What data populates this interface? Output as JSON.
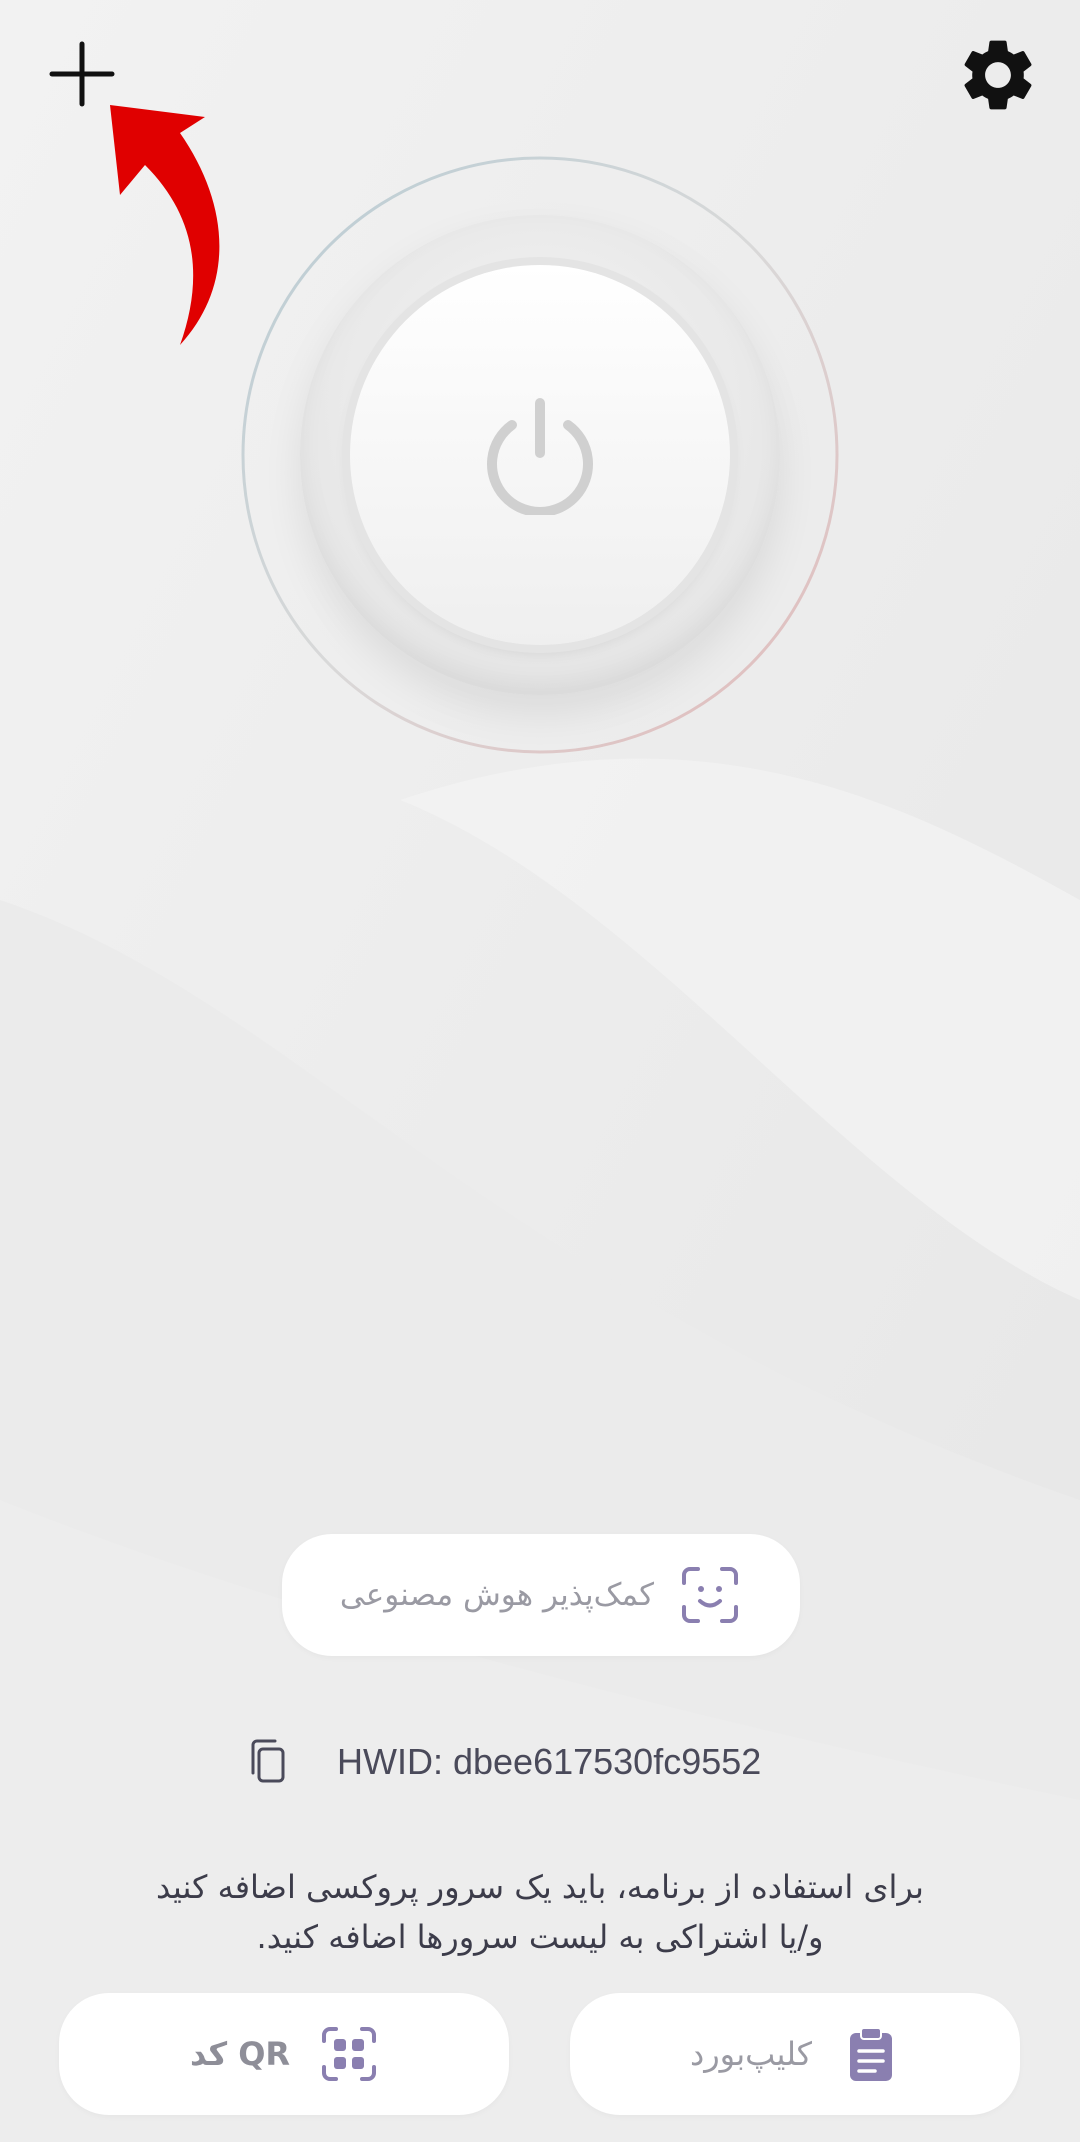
{
  "header": {
    "plus_icon": "plus-icon",
    "settings_icon": "gear-icon",
    "hint_icon": "red-curved-arrow-icon"
  },
  "power": {
    "icon": "power-icon"
  },
  "ai_button": {
    "label": "کمک‌پذیر هوش مصنوعی",
    "icon": "face-scan-icon"
  },
  "hwid": {
    "text": "HWID: dbee617530fc9552",
    "icon": "copy-icon"
  },
  "info": {
    "line1": "برای استفاده از برنامه، باید یک سرور پروکسی اضافه کنید",
    "line2": "و/یا اشتراکی به لیست سرورها اضافه کنید."
  },
  "bottom": {
    "qr_label": "QR کد",
    "qr_icon": "qr-scan-icon",
    "clipboard_label": "کلیپ‌بورد",
    "clipboard_icon": "clipboard-icon"
  },
  "colors": {
    "background": "#ededed",
    "accent": "#8a7fb0",
    "hint_arrow": "#e00000"
  }
}
